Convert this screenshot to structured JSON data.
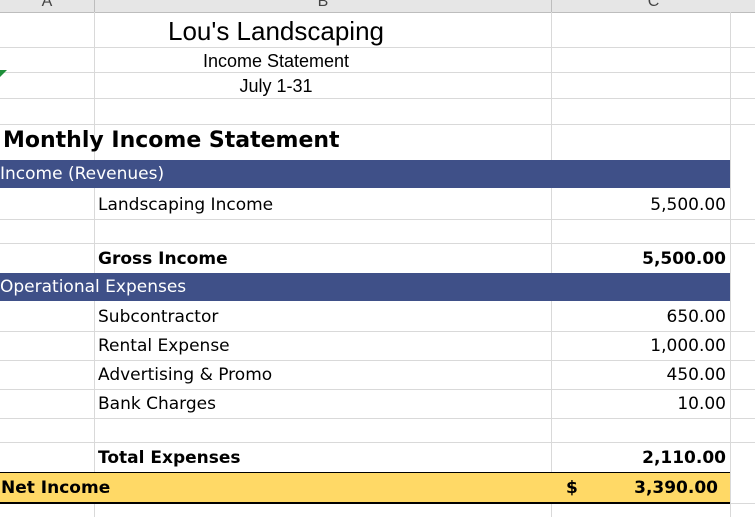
{
  "columns": [
    "A",
    "B",
    "C"
  ],
  "header": {
    "company": "Lou's Landscaping",
    "statement": "Income Statement",
    "period": "July 1-31"
  },
  "report_title": "Monthly Income Statement",
  "income": {
    "section_label": "Income (Revenues)",
    "items": [
      {
        "label": "Landscaping Income",
        "amount": "5,500.00"
      }
    ],
    "total_label": "Gross Income",
    "total_amount": "5,500.00"
  },
  "expenses": {
    "section_label": "Operational Expenses",
    "items": [
      {
        "label": "Subcontractor",
        "amount": "650.00"
      },
      {
        "label": "Rental Expense",
        "amount": "1,000.00"
      },
      {
        "label": "Advertising & Promo",
        "amount": "450.00"
      },
      {
        "label": "Bank Charges",
        "amount": "10.00"
      }
    ],
    "total_label": "Total Expenses",
    "total_amount": "2,110.00"
  },
  "net_income": {
    "label": "Net Income",
    "currency": "$",
    "amount": "3,390.00"
  },
  "colors": {
    "band": "#3f5088",
    "net_fill": "#ffd966",
    "grid": "#d9d9d9"
  }
}
